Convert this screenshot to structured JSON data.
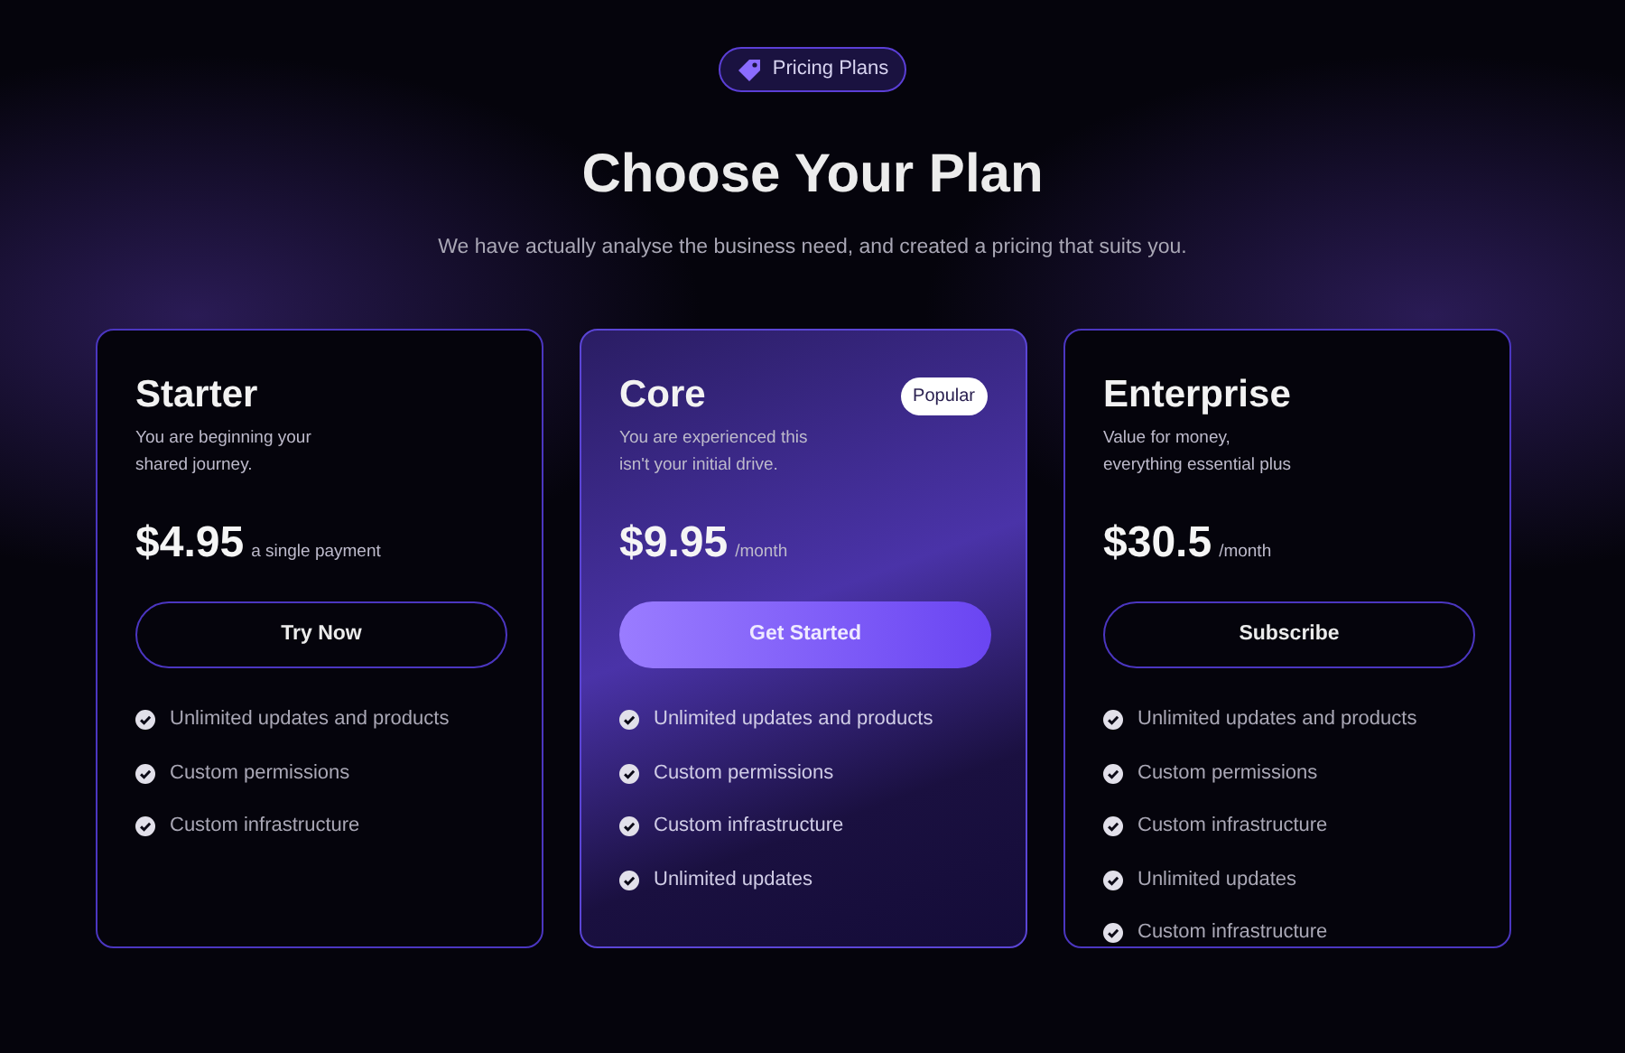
{
  "badge": {
    "label": "Pricing Plans"
  },
  "title": "Choose Your Plan",
  "subtitle": "We have actually analyse the business need, and created a pricing that suits you.",
  "plans": [
    {
      "kind": "plain",
      "name": "Starter",
      "description": [
        "You are beginning your",
        "shared journey."
      ],
      "price": "$4.95",
      "period": "a single payment",
      "button": "Try Now",
      "features": [
        "Unlimited updates and products",
        "Custom permissions",
        "Custom infrastructure"
      ]
    },
    {
      "kind": "highlighted",
      "name": "Core",
      "tag": "Popular",
      "description": [
        "You are experienced this",
        "isn't your initial drive."
      ],
      "price": "$9.95",
      "period": "/month",
      "button": "Get Started",
      "features": [
        "Unlimited updates and products",
        "Custom permissions",
        "Custom infrastructure",
        "Unlimited updates"
      ]
    },
    {
      "kind": "plain",
      "name": "Enterprise",
      "description": [
        "Value for money,",
        "everything essential plus"
      ],
      "price": "$30.5",
      "period": "/month",
      "button": "Subscribe",
      "features": [
        "Unlimited updates and products",
        "Custom permissions",
        "Custom infrastructure",
        "Unlimited updates",
        "Custom infrastructure"
      ]
    }
  ]
}
